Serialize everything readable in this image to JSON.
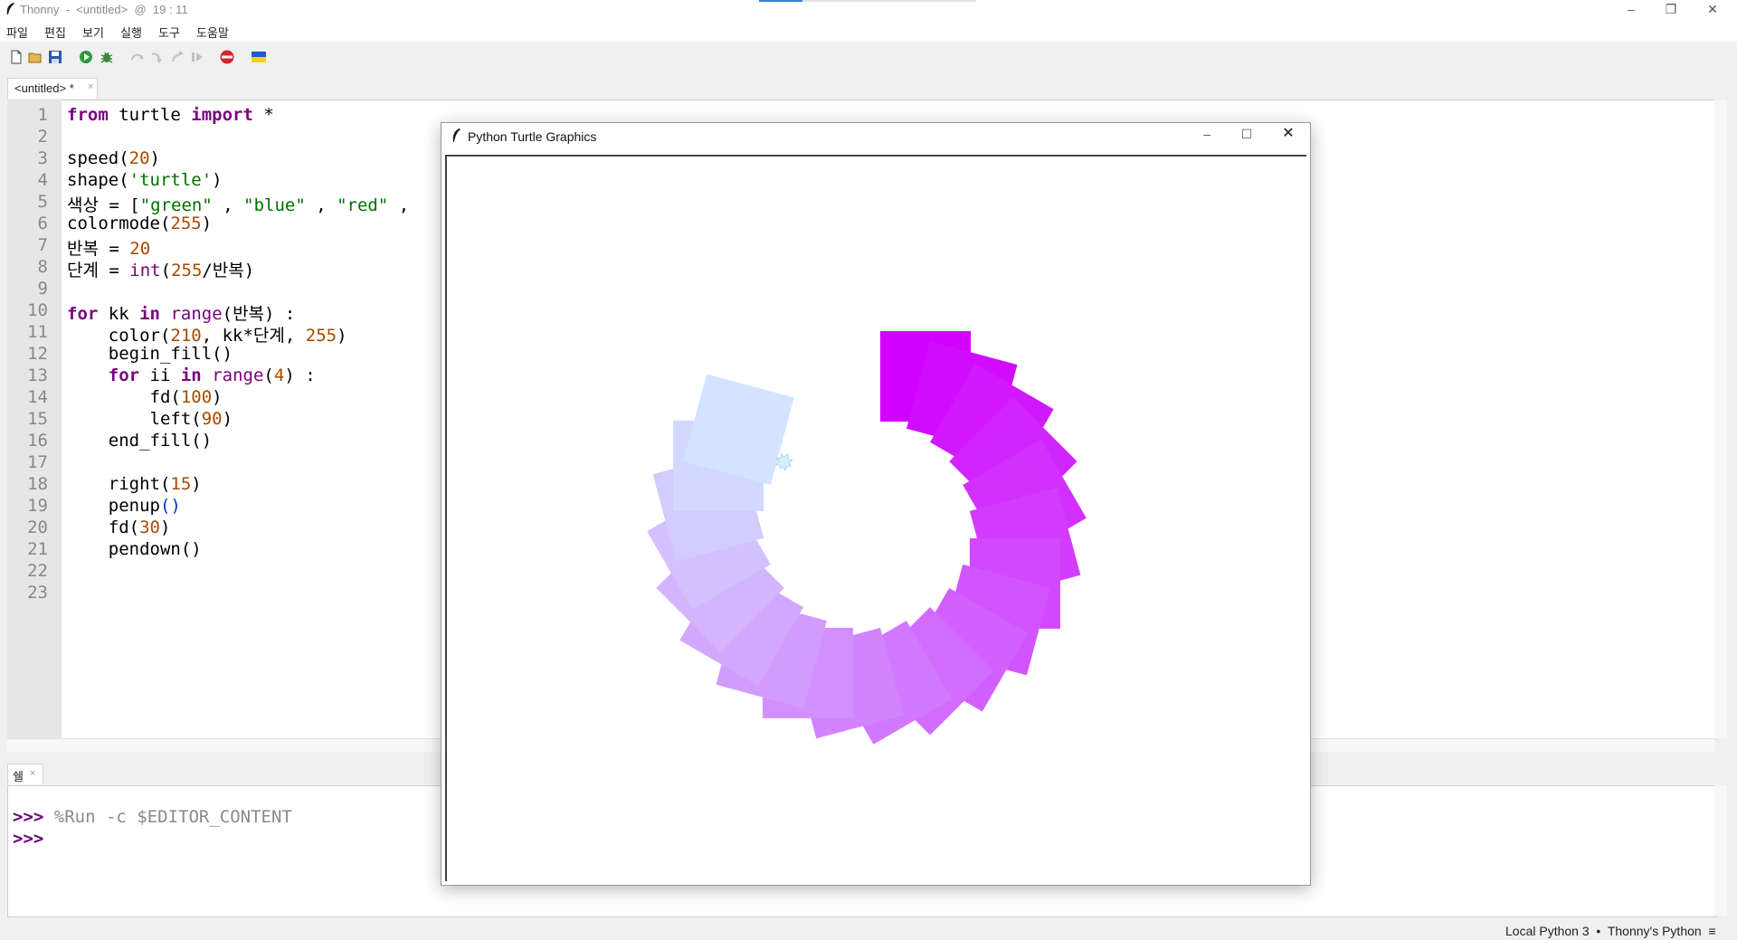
{
  "window": {
    "title": "Thonny  -  <untitled>  @  19 : 11",
    "min_glyph": "–",
    "max_glyph": "❐",
    "close_glyph": "✕"
  },
  "menu": [
    "파일",
    "편집",
    "보기",
    "실행",
    "도구",
    "도움말"
  ],
  "toolbar": [
    "new-icon",
    "open-icon",
    "save-icon",
    "run-icon",
    "debug-icon",
    "step-over-icon",
    "step-into-icon",
    "step-out-icon",
    "resume-icon",
    "stop-icon",
    "ukraine-flag-icon"
  ],
  "editor": {
    "tab_label": "<untitled> *",
    "tab_close": "×",
    "line_numbers": [
      "1",
      "2",
      "3",
      "4",
      "5",
      "6",
      "7",
      "8",
      "9",
      "10",
      "11",
      "12",
      "13",
      "14",
      "15",
      "16",
      "17",
      "18",
      "19",
      "20",
      "21",
      "22",
      "23"
    ]
  },
  "shell": {
    "tab_label": "쉘",
    "tab_close": "×",
    "prompt": ">>>",
    "command": " %Run -c $EDITOR_CONTENT"
  },
  "status": {
    "interpreter": "Local Python 3  •  Thonny's Python  ≡"
  },
  "turtle_window": {
    "title": "Python Turtle Graphics",
    "min_glyph": "–",
    "max_glyph": "☐",
    "close_glyph": "✕"
  },
  "colors": {
    "keyword": "#7a0080",
    "number": "#a74a00",
    "string": "#007000",
    "square_start": "#d2ffff",
    "square_end": "#d200ff"
  }
}
